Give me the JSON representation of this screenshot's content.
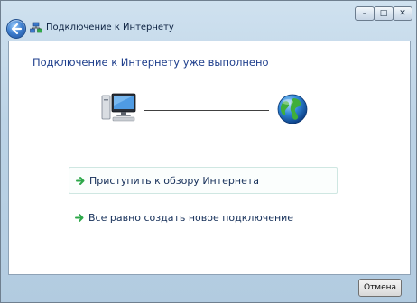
{
  "window": {
    "title": "Подключение к Интернету",
    "controls": {
      "minimize": "–",
      "maximize": "□",
      "close": "✕"
    }
  },
  "main": {
    "heading": "Подключение к Интернету уже выполнено",
    "options": [
      {
        "label": "Приступить к обзору Интернета"
      },
      {
        "label": "Все равно создать новое подключение"
      }
    ]
  },
  "footer": {
    "cancel_label": "Отмена"
  },
  "colors": {
    "heading": "#1e3e8c",
    "option_arrow": "#2ea84a",
    "title_bar": "#bcd3e6"
  },
  "icons": [
    "back-arrow-icon",
    "network-icon",
    "computer-icon",
    "globe-icon",
    "green-arrow-icon"
  ]
}
